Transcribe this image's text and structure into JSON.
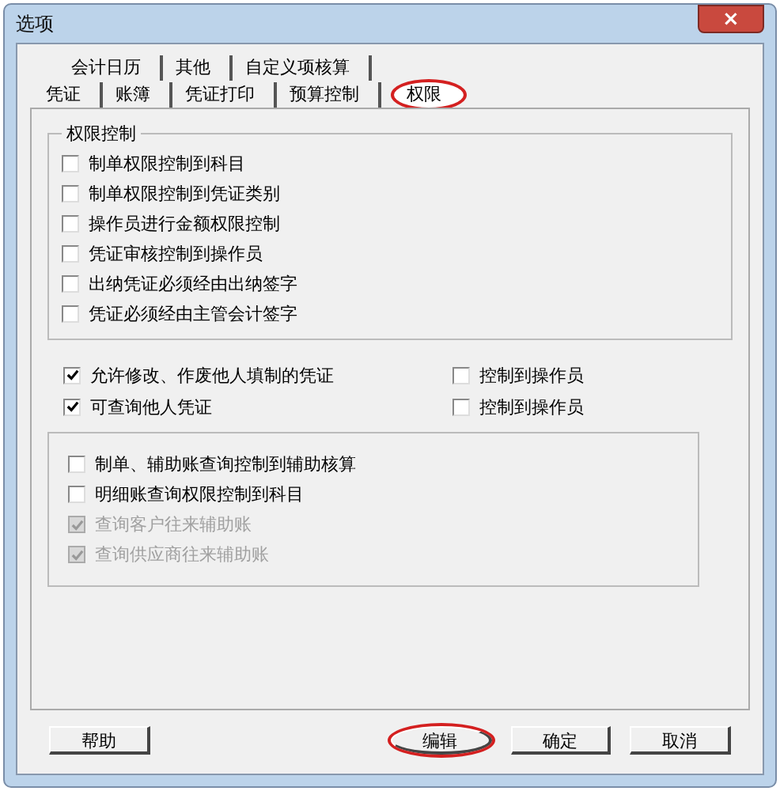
{
  "window": {
    "title": "选项",
    "close": "×"
  },
  "tab_rows": [
    [
      {
        "label": "会计日历",
        "selected": false,
        "highlighted": false
      },
      {
        "label": "其他",
        "selected": false,
        "highlighted": false
      },
      {
        "label": "自定义项核算",
        "selected": false,
        "highlighted": false
      }
    ],
    [
      {
        "label": "凭证",
        "selected": false,
        "highlighted": false
      },
      {
        "label": "账簿",
        "selected": false,
        "highlighted": false
      },
      {
        "label": "凭证打印",
        "selected": false,
        "highlighted": false
      },
      {
        "label": "预算控制",
        "selected": false,
        "highlighted": false
      },
      {
        "label": "权限",
        "selected": true,
        "highlighted": true
      }
    ]
  ],
  "permission_group": {
    "title": "权限控制",
    "options": [
      {
        "label": "制单权限控制到科目",
        "checked": false,
        "disabled": false
      },
      {
        "label": "制单权限控制到凭证类别",
        "checked": false,
        "disabled": false
      },
      {
        "label": "操作员进行金额权限控制",
        "checked": false,
        "disabled": false
      },
      {
        "label": "凭证审核控制到操作员",
        "checked": false,
        "disabled": false
      },
      {
        "label": "出纳凭证必须经由出纳签字",
        "checked": false,
        "disabled": false
      },
      {
        "label": "凭证必须经由主管会计签字",
        "checked": false,
        "disabled": false
      }
    ]
  },
  "voucher_rows": [
    {
      "main": {
        "label": "允许修改、作废他人填制的凭证",
        "checked": true,
        "disabled": false
      },
      "sub": {
        "label": "控制到操作员",
        "checked": false,
        "disabled": false
      }
    },
    {
      "main": {
        "label": "可查询他人凭证",
        "checked": true,
        "disabled": false
      },
      "sub": {
        "label": "控制到操作员",
        "checked": false,
        "disabled": false
      }
    }
  ],
  "ledger_group": {
    "options": [
      {
        "label": "制单、辅助账查询控制到辅助核算",
        "checked": false,
        "disabled": false
      },
      {
        "label": "明细账查询权限控制到科目",
        "checked": false,
        "disabled": false
      },
      {
        "label": "查询客户往来辅助账",
        "checked": true,
        "disabled": true
      },
      {
        "label": "查询供应商往来辅助账",
        "checked": true,
        "disabled": true
      }
    ]
  },
  "buttons": [
    {
      "label": "帮助",
      "highlighted": false
    },
    {
      "label": "编辑",
      "highlighted": true
    },
    {
      "label": "确定",
      "highlighted": false
    },
    {
      "label": "取消",
      "highlighted": false
    }
  ]
}
